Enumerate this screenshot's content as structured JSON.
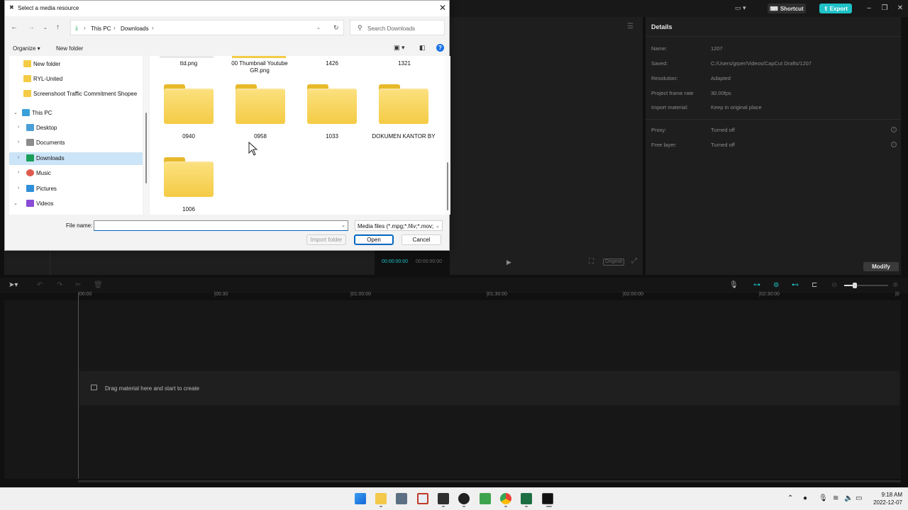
{
  "capcut": {
    "shortcut_label": "Shortcut",
    "export_label": "Export",
    "details_title": "Details",
    "details": [
      {
        "label": "Name:",
        "value": "1207"
      },
      {
        "label": "Saved:",
        "value": "C:/Users/grper/Videos/CapCut Drafts/1207"
      },
      {
        "label": "Resolution:",
        "value": "Adapted"
      },
      {
        "label": "Project frame rate",
        "value": "30.00fps"
      },
      {
        "label": "Import material:",
        "value": "Keep in original place"
      },
      {
        "label": "Proxy:",
        "value": "Turned off"
      },
      {
        "label": "Free layer:",
        "value": "Turned off"
      }
    ],
    "modify_label": "Modify",
    "timecode_current": "00:00:00:00",
    "timecode_total": "00:00:00:00",
    "original_label": "Original",
    "ruler_ticks": [
      "|00:00",
      "|00:30",
      "|01:00:00",
      "|01:30:00",
      "|02:00:00",
      "|02:30:00",
      "|0"
    ],
    "drop_text": "Drag material here and start to create"
  },
  "dialog": {
    "title": "Select a media resource",
    "breadcrumb": [
      "This PC",
      "Downloads"
    ],
    "search_placeholder": "Search Downloads",
    "organize_label": "Organize ▾",
    "new_folder_label": "New folder",
    "nav_items": [
      {
        "label": "New folder",
        "icon": "folder-icon"
      },
      {
        "label": "RYL-United",
        "icon": "folder-icon"
      },
      {
        "label": "Screenshoot Traffic Commitment Shopee",
        "icon": "folder-icon"
      },
      {
        "label": "This PC",
        "icon": "pc-icon"
      },
      {
        "label": "Desktop",
        "icon": "desktop-icon"
      },
      {
        "label": "Documents",
        "icon": "documents-icon"
      },
      {
        "label": "Downloads",
        "icon": "downloads-icon"
      },
      {
        "label": "Music",
        "icon": "music-icon"
      },
      {
        "label": "Pictures",
        "icon": "pictures-icon"
      },
      {
        "label": "Videos",
        "icon": "videos-icon"
      }
    ],
    "top_row_labels": [
      "ttd.png",
      "00 Thumbnail Youtube GR.png",
      "1426",
      "1321"
    ],
    "folders": [
      "0940",
      "0958",
      "1033",
      "DOKUMEN KANTOR BY",
      "1006"
    ],
    "file_name_label": "File name:",
    "file_name_value": "",
    "filter_text": "Media files (*.mpg;*.f4v;*.mov;",
    "import_folder_label": "Import folder",
    "open_label": "Open",
    "cancel_label": "Cancel"
  },
  "taskbar": {
    "time": "9:18 AM",
    "date": "2022-12-07"
  }
}
